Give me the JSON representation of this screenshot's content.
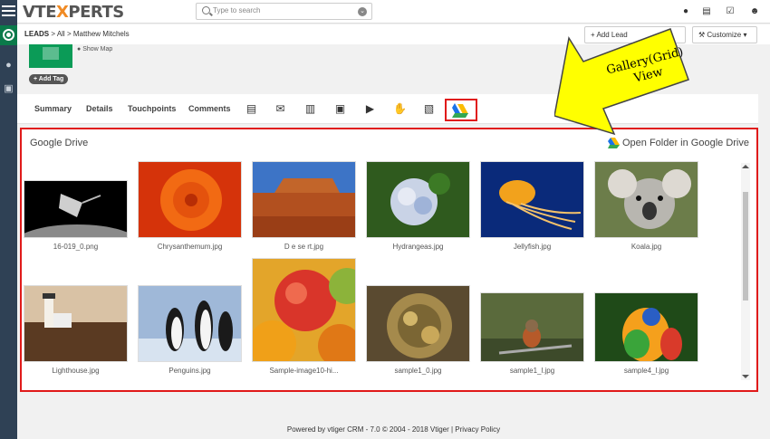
{
  "app": {
    "logo_vt": "VTE",
    "logo_x": "X",
    "logo_perts": "PERTS"
  },
  "search": {
    "placeholder": "Type to search"
  },
  "breadcrumb": {
    "module": "LEADS",
    "sep1": ">",
    "all": "All",
    "sep2": ">",
    "record": "Matthew Mitchels"
  },
  "actions": {
    "add_lead": "Add Lead",
    "customize": "Customize"
  },
  "header": {
    "show_map": "Show Map",
    "add_tag": "Add Tag"
  },
  "tabs": [
    "Summary",
    "Details",
    "Touchpoints",
    "Comments"
  ],
  "drive": {
    "title": "Google Drive",
    "open_folder": "Open Folder in Google Drive",
    "files": [
      {
        "name": "16-019_0.png",
        "kind": "space"
      },
      {
        "name": "Chrysanthemum.jpg",
        "kind": "flower-orange"
      },
      {
        "name": "D e se rt.jpg",
        "kind": "desert"
      },
      {
        "name": "Hydrangeas.jpg",
        "kind": "hydrangea"
      },
      {
        "name": "Jellyfish.jpg",
        "kind": "jellyfish"
      },
      {
        "name": "Koala.jpg",
        "kind": "koala"
      },
      {
        "name": "Lighthouse.jpg",
        "kind": "lighthouse"
      },
      {
        "name": "Penguins.jpg",
        "kind": "penguins"
      },
      {
        "name": "Sample-image10-hi...",
        "kind": "apples"
      },
      {
        "name": "sample1_0.jpg",
        "kind": "watch"
      },
      {
        "name": "sample1_l.jpg",
        "kind": "bird"
      },
      {
        "name": "sample4_l.jpg",
        "kind": "parrot"
      }
    ]
  },
  "callout": {
    "line1": "Gallery(Grid)",
    "line2": "View"
  },
  "footer": {
    "text": "Powered by vtiger CRM - 7.0  © 2004 - 2018  Vtiger |",
    "privacy": "Privacy Policy"
  },
  "colors": {
    "accent_red": "#e01a1a",
    "callout_yellow": "#ffff00",
    "rail": "#2f4155",
    "brand_green": "#0b7a4a"
  }
}
